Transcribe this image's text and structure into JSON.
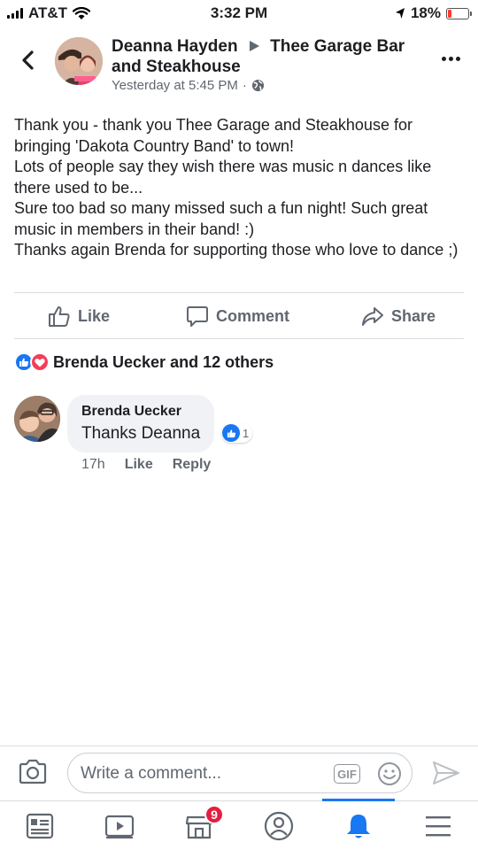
{
  "status_bar": {
    "carrier": "AT&T",
    "time": "3:32 PM",
    "battery": "18%",
    "battery_level": 0.18,
    "icons": [
      "signal-icon",
      "wifi-icon",
      "location-arrow-icon",
      "battery-icon"
    ]
  },
  "post": {
    "author": "Deanna Hayden",
    "target": "Thee Garage Bar and Steakhouse",
    "timestamp": "Yesterday at 5:45 PM",
    "privacy_icon": "globe-icon",
    "lines": [
      "Thank you - thank you Thee Garage and Steakhouse for bringing 'Dakota Country Band' to town!",
      "Lots of people say they wish there was music n dances like there used to be...",
      "Sure too bad so many missed such a fun night!  Such great music in members in their band! :)",
      "Thanks again Brenda for supporting those who love to dance ;)"
    ]
  },
  "actions": {
    "like": "Like",
    "comment": "Comment",
    "share": "Share"
  },
  "reactions": {
    "summary": "Brenda Uecker and 12 others",
    "types": [
      "like",
      "love"
    ],
    "colors": {
      "like": "#1877f2",
      "love": "#f33e58"
    }
  },
  "comment": {
    "author": "Brenda Uecker",
    "text": "Thanks Deanna",
    "reaction_count": "1",
    "age": "17h",
    "like_label": "Like",
    "reply_label": "Reply"
  },
  "composer": {
    "placeholder": "Write a comment...",
    "gif_label": "GIF"
  },
  "tab_bar": {
    "tabs": [
      "news-feed-icon",
      "watch-icon",
      "marketplace-icon",
      "profile-icon",
      "notifications-icon",
      "menu-icon"
    ],
    "active": "notifications-icon",
    "marketplace_badge": "9",
    "accent": "#1877f2"
  }
}
